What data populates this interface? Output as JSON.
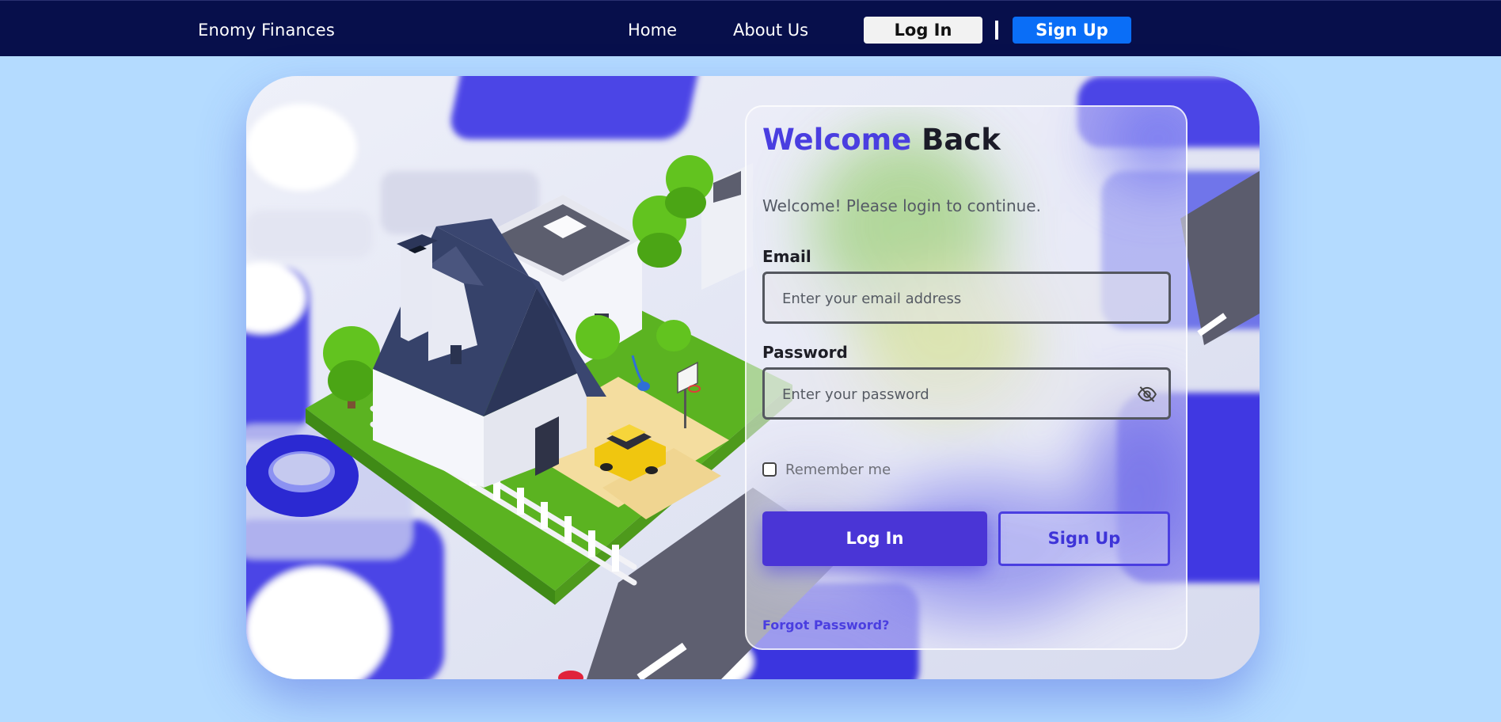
{
  "nav": {
    "brand": "Enomy Finances",
    "links": [
      "Home",
      "About Us"
    ],
    "login_label": "Log In",
    "signup_label": "Sign Up"
  },
  "login": {
    "title_accent": "Welcome",
    "title_rest": "Back",
    "subtitle": "Welcome! Please login to continue.",
    "email": {
      "label": "Email",
      "placeholder": "Enter your email address",
      "value": ""
    },
    "password": {
      "label": "Password",
      "placeholder": "Enter your password",
      "value": ""
    },
    "remember_label": "Remember me",
    "remember_checked": false,
    "login_button": "Log In",
    "signup_button": "Sign Up",
    "forgot_link": "Forgot Password?"
  },
  "icons": {
    "password_toggle": "eye-slash-icon"
  },
  "colors": {
    "page_background": "#b4dbff",
    "navbar": "#070f4b",
    "nav_signup": "#0a6ef7",
    "accent": "#4a3ee0",
    "button_primary": "#4a35d6"
  }
}
